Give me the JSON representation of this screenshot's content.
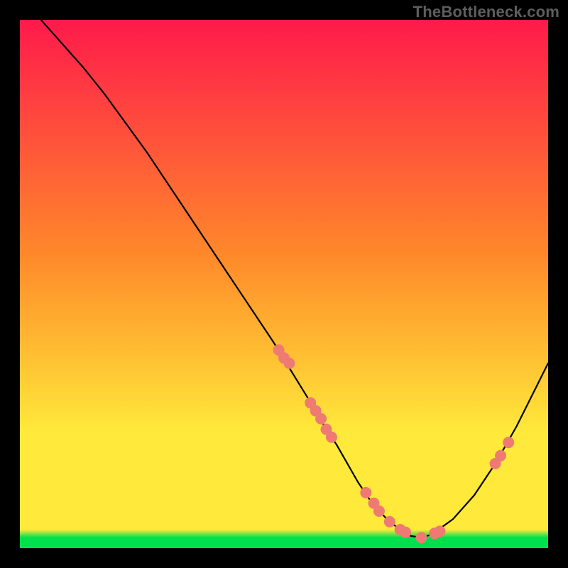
{
  "watermark": "TheBottleneck.com",
  "chart_data": {
    "type": "line",
    "title": "",
    "xlabel": "",
    "ylabel": "",
    "xlim": [
      0,
      100
    ],
    "ylim": [
      0,
      100
    ],
    "legend": null,
    "grid": false,
    "background_gradient": {
      "top": "#ff1a4b",
      "mid1": "#ff8a2a",
      "mid2": "#ffe93a",
      "bottom": "#00e04c"
    },
    "series": [
      {
        "name": "curve",
        "type": "line",
        "color": "#000000",
        "x": [
          4,
          8,
          12,
          16,
          20,
          24,
          28,
          32,
          36,
          40,
          44,
          48,
          52,
          56,
          58,
          60,
          62,
          64,
          66,
          68,
          70,
          72,
          74,
          76,
          78,
          82,
          86,
          90,
          94,
          98,
          100
        ],
        "y": [
          100,
          95.5,
          91,
          86,
          80.5,
          75,
          69,
          63,
          57,
          51,
          45,
          39,
          32.5,
          26,
          22.5,
          19.5,
          16,
          12.5,
          9.5,
          7,
          5,
          3.5,
          2.3,
          2,
          2.6,
          5.5,
          10,
          16,
          23,
          31,
          35
        ]
      },
      {
        "name": "highlight-points",
        "type": "scatter",
        "color": "#ef7a73",
        "radius": 8,
        "x": [
          49,
          50,
          51,
          55,
          56,
          57,
          58,
          59,
          65.5,
          67,
          68,
          70,
          72,
          73,
          76,
          78.5,
          79.5,
          90,
          91,
          92.5
        ],
        "y": [
          37.5,
          36,
          35,
          27.5,
          26,
          24.5,
          22.5,
          21,
          10.5,
          8.5,
          7,
          5,
          3.5,
          3,
          2,
          2.8,
          3.2,
          16,
          17.5,
          20
        ]
      }
    ]
  }
}
